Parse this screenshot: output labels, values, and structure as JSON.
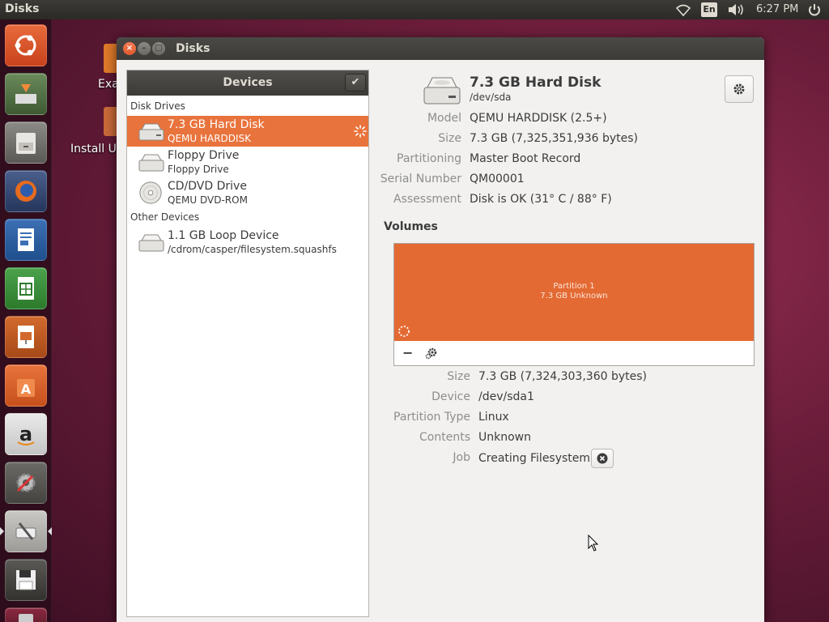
{
  "panel": {
    "app_title": "Disks",
    "language": "En",
    "clock": "6:27 PM"
  },
  "desktop": {
    "icons": [
      {
        "label": "Exa"
      },
      {
        "label": "Install Ub"
      }
    ]
  },
  "window": {
    "title": "Disks"
  },
  "devices": {
    "header": "Devices",
    "section_disk_drives": "Disk Drives",
    "section_other_devices": "Other Devices",
    "drives": [
      {
        "name": "7.3 GB Hard Disk",
        "subtitle": "QEMU HARDDISK"
      },
      {
        "name": "Floppy Drive",
        "subtitle": "Floppy Drive"
      },
      {
        "name": "CD/DVD Drive",
        "subtitle": "QEMU DVD-ROM"
      }
    ],
    "other": [
      {
        "name": "1.1 GB Loop Device",
        "subtitle": "/cdrom/casper/filesystem.squashfs"
      }
    ]
  },
  "disk": {
    "title": "7.3 GB Hard Disk",
    "device": "/dev/sda",
    "fields": [
      {
        "label": "Model",
        "value": "QEMU HARDDISK (2.5+)"
      },
      {
        "label": "Size",
        "value": "7.3 GB (7,325,351,936 bytes)"
      },
      {
        "label": "Partitioning",
        "value": "Master Boot Record"
      },
      {
        "label": "Serial Number",
        "value": "QM00001"
      },
      {
        "label": "Assessment",
        "value": "Disk is OK (31° C / 88° F)"
      }
    ]
  },
  "volumes": {
    "heading": "Volumes",
    "partition_name": "Partition 1",
    "partition_size": "7.3 GB Unknown",
    "partition_color": "#e46a34",
    "remove_label": "−",
    "fields": [
      {
        "label": "Size",
        "value": "7.3 GB (7,324,303,360 bytes)"
      },
      {
        "label": "Device",
        "value": "/dev/sda1"
      },
      {
        "label": "Partition Type",
        "value": "Linux"
      },
      {
        "label": "Contents",
        "value": "Unknown"
      },
      {
        "label": "Job",
        "value": "Creating Filesystem"
      }
    ]
  },
  "colors": {
    "accent": "#e9733c",
    "panel_dark": "#3c3b37"
  }
}
